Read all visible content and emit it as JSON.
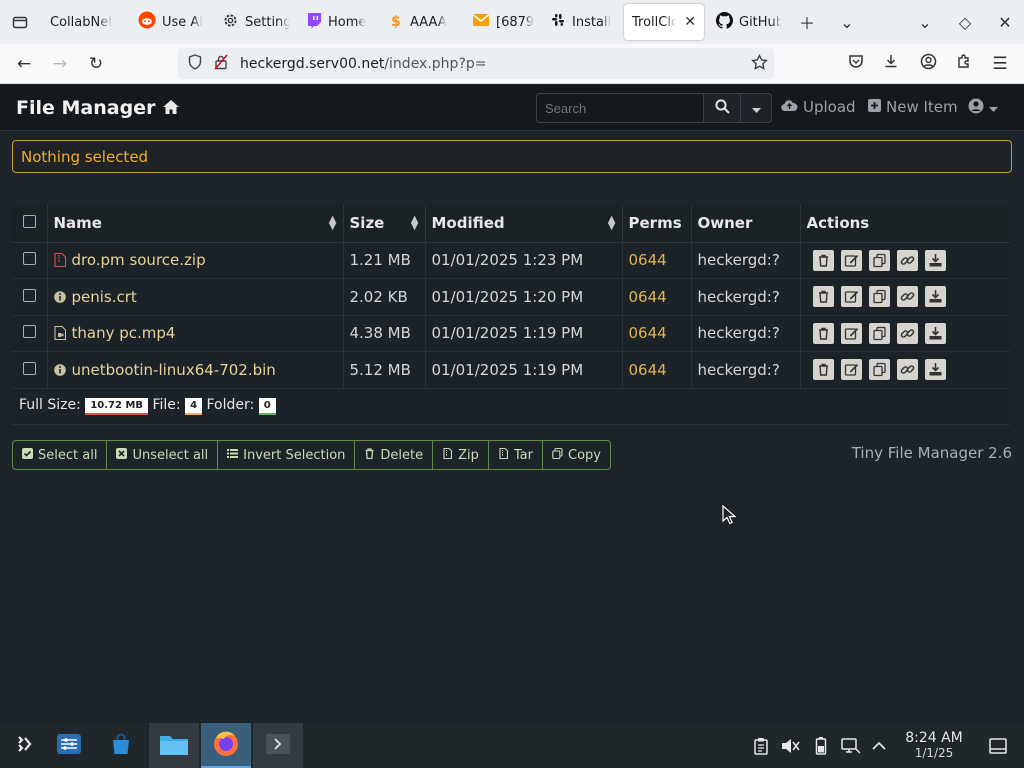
{
  "browser": {
    "tabs": [
      {
        "label": "CollabNet",
        "icon": "collabnet-icon"
      },
      {
        "label": "Use AI",
        "icon": "reddit-icon"
      },
      {
        "label": "Settings",
        "icon": "gear-icon"
      },
      {
        "label": "Home",
        "icon": "twitch-icon"
      },
      {
        "label": "AAAA",
        "icon": "bitcoin-icon"
      },
      {
        "label": "[6879",
        "icon": "mail-icon"
      },
      {
        "label": "Install",
        "icon": "slack-icon"
      },
      {
        "label": "TrollClo",
        "icon": "",
        "active": true
      },
      {
        "label": "GitHub",
        "icon": "github-icon"
      }
    ],
    "url_host": "heckergd.serv00.net",
    "url_path": "/index.php?p="
  },
  "fm": {
    "title": "File Manager",
    "search_placeholder": "Search",
    "upload_label": "Upload",
    "new_item_label": "New Item",
    "alert": "Nothing selected",
    "columns": {
      "name": "Name",
      "size": "Size",
      "modified": "Modified",
      "perms": "Perms",
      "owner": "Owner",
      "actions": "Actions"
    },
    "files": [
      {
        "name": "dro.pm source.zip",
        "icon": "zip-file-icon",
        "size": "1.21 MB",
        "modified": "01/01/2025 1:23 PM",
        "perms": "0644",
        "owner": "heckergd:?"
      },
      {
        "name": "penis.crt",
        "icon": "info-circle-icon",
        "size": "2.02 KB",
        "modified": "01/01/2025 1:20 PM",
        "perms": "0644",
        "owner": "heckergd:?"
      },
      {
        "name": "thany pc.mp4",
        "icon": "video-file-icon",
        "size": "4.38 MB",
        "modified": "01/01/2025 1:19 PM",
        "perms": "0644",
        "owner": "heckergd:?"
      },
      {
        "name": "unetbootin-linux64-702.bin",
        "icon": "info-circle-icon",
        "size": "5.12 MB",
        "modified": "01/01/2025 1:19 PM",
        "perms": "0644",
        "owner": "heckergd:?"
      }
    ],
    "footer": {
      "full_size_label": "Full Size:",
      "full_size": "10.72 MB",
      "file_label": "File:",
      "file_count": "4",
      "folder_label": "Folder:",
      "folder_count": "0"
    },
    "bulk_buttons": [
      "Select all",
      "Unselect all",
      "Invert Selection",
      "Delete",
      "Zip",
      "Tar",
      "Copy"
    ],
    "version": "Tiny File Manager 2.6"
  },
  "taskbar": {
    "time": "8:24 AM",
    "date": "1/1/25"
  },
  "colors": {
    "page_bg": "#1c2429",
    "alert_text": "#f0ad24",
    "filename": "#e6d29a",
    "perms": "#e4b44d",
    "button_border": "#5f8a4e"
  }
}
